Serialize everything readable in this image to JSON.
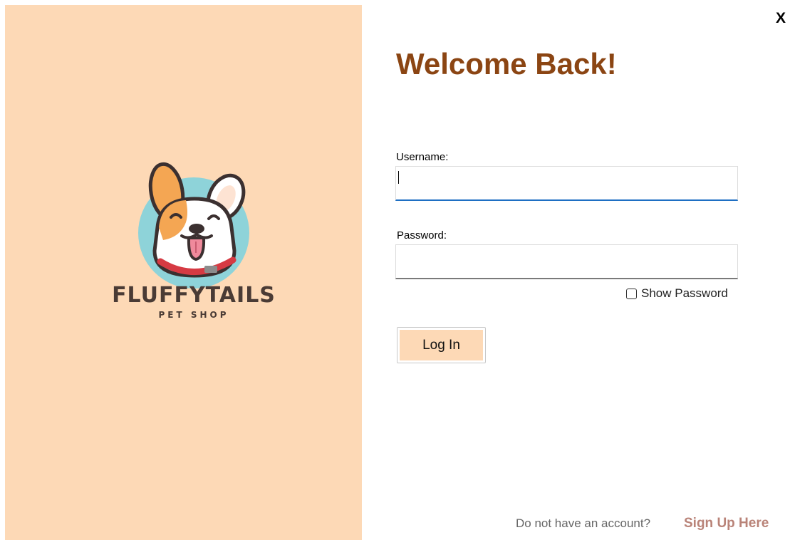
{
  "window": {
    "close_label": "X"
  },
  "brand": {
    "name": "FLUFFYTAILS",
    "tagline": "PET SHOP",
    "logo_icon": "dog-face-logo",
    "panel_color": "#fdd9b6"
  },
  "form": {
    "heading": "Welcome Back!",
    "heading_color": "#8b4513",
    "username_label": "Username:",
    "username_value": "",
    "password_label": "Password:",
    "password_value": "",
    "show_password_label": "Show Password",
    "show_password_checked": false,
    "login_label": "Log In"
  },
  "footer": {
    "prompt": "Do not have an account?",
    "signup_label": "Sign Up Here",
    "signup_color": "#b98378"
  }
}
